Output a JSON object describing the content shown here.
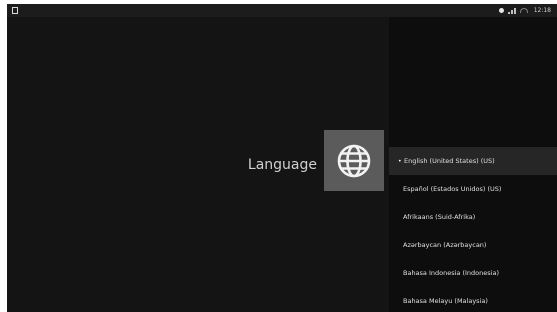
{
  "status_bar": {
    "icons": [
      "app-icon",
      "notification-dot-icon",
      "signal-icon",
      "wifi-icon"
    ],
    "time": "12:18"
  },
  "page": {
    "title": "Language",
    "icon": "globe-icon"
  },
  "language_list": {
    "selected_marker": "•",
    "items": [
      {
        "label": "English (United States) (US)",
        "selected": true
      },
      {
        "label": "Español (Estados Unidos) (US)",
        "selected": false
      },
      {
        "label": "Afrikaans (Suid-Afrika)",
        "selected": false
      },
      {
        "label": "Azərbaycan (Azərbaycan)",
        "selected": false
      },
      {
        "label": "Bahasa Indonesia (Indonesia)",
        "selected": false
      },
      {
        "label": "Bahasa Melayu (Malaysia)",
        "selected": false
      }
    ]
  },
  "colors": {
    "background": "#141414",
    "panel": "#0d0d0d",
    "tile": "#5b5b5b",
    "selected_row": "#262626"
  }
}
